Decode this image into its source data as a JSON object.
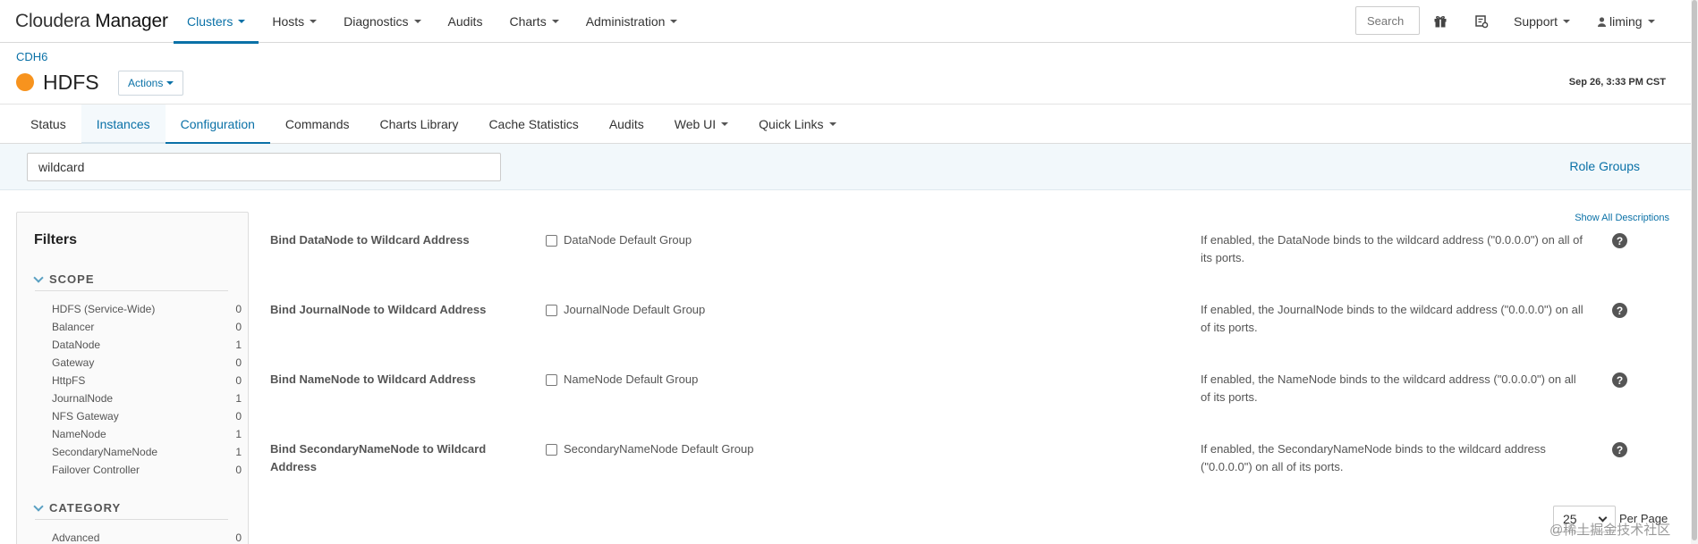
{
  "brand": {
    "part1": "Cloudera",
    "part2": "Manager"
  },
  "nav": [
    {
      "label": "Clusters",
      "dropdown": true,
      "active": true
    },
    {
      "label": "Hosts",
      "dropdown": true
    },
    {
      "label": "Diagnostics",
      "dropdown": true
    },
    {
      "label": "Audits",
      "dropdown": false
    },
    {
      "label": "Charts",
      "dropdown": true
    },
    {
      "label": "Administration",
      "dropdown": true
    }
  ],
  "top_search_placeholder": "Search",
  "top_icons": [
    "gift-icon",
    "tasks-icon"
  ],
  "support_label": "Support",
  "user_label": "liming",
  "breadcrumb": "CDH6",
  "service": {
    "name": "HDFS",
    "status_color": "#f7931e",
    "actions_label": "Actions"
  },
  "timestamp": "Sep 26, 3:33 PM CST",
  "tabs": [
    {
      "label": "Status"
    },
    {
      "label": "Instances",
      "highlight": true
    },
    {
      "label": "Configuration",
      "active": true
    },
    {
      "label": "Commands"
    },
    {
      "label": "Charts Library"
    },
    {
      "label": "Cache Statistics"
    },
    {
      "label": "Audits"
    },
    {
      "label": "Web UI",
      "dropdown": true
    },
    {
      "label": "Quick Links",
      "dropdown": true
    }
  ],
  "filter_value": "wildcard",
  "role_groups_label": "Role Groups",
  "filters": {
    "title": "Filters",
    "scope": {
      "label": "SCOPE",
      "items": [
        {
          "label": "HDFS (Service-Wide)",
          "count": "0"
        },
        {
          "label": "Balancer",
          "count": "0"
        },
        {
          "label": "DataNode",
          "count": "1"
        },
        {
          "label": "Gateway",
          "count": "0"
        },
        {
          "label": "HttpFS",
          "count": "0"
        },
        {
          "label": "JournalNode",
          "count": "1"
        },
        {
          "label": "NFS Gateway",
          "count": "0"
        },
        {
          "label": "NameNode",
          "count": "1"
        },
        {
          "label": "SecondaryNameNode",
          "count": "1"
        },
        {
          "label": "Failover Controller",
          "count": "0"
        }
      ]
    },
    "category": {
      "label": "CATEGORY",
      "items": [
        {
          "label": "Advanced",
          "count": "0"
        }
      ]
    }
  },
  "show_all_label": "Show All Descriptions",
  "configs": [
    {
      "name": "Bind DataNode to Wildcard Address",
      "group": "DataNode Default Group",
      "description": "If enabled, the DataNode binds to the wildcard address (\"0.0.0.0\") on all of its ports."
    },
    {
      "name": "Bind JournalNode to Wildcard Address",
      "group": "JournalNode Default Group",
      "description": "If enabled, the JournalNode binds to the wildcard address (\"0.0.0.0\") on all of its ports."
    },
    {
      "name": "Bind NameNode to Wildcard Address",
      "group": "NameNode Default Group",
      "description": "If enabled, the NameNode binds to the wildcard address (\"0.0.0.0\") on all of its ports."
    },
    {
      "name": "Bind SecondaryNameNode to Wildcard Address",
      "group": "SecondaryNameNode Default Group",
      "description": "If enabled, the SecondaryNameNode binds to the wildcard address (\"0.0.0.0\") on all of its ports."
    }
  ],
  "help_glyph": "?",
  "per_page": {
    "value": "25",
    "label": "Per Page"
  },
  "watermark": "@稀土掘金技术社区"
}
